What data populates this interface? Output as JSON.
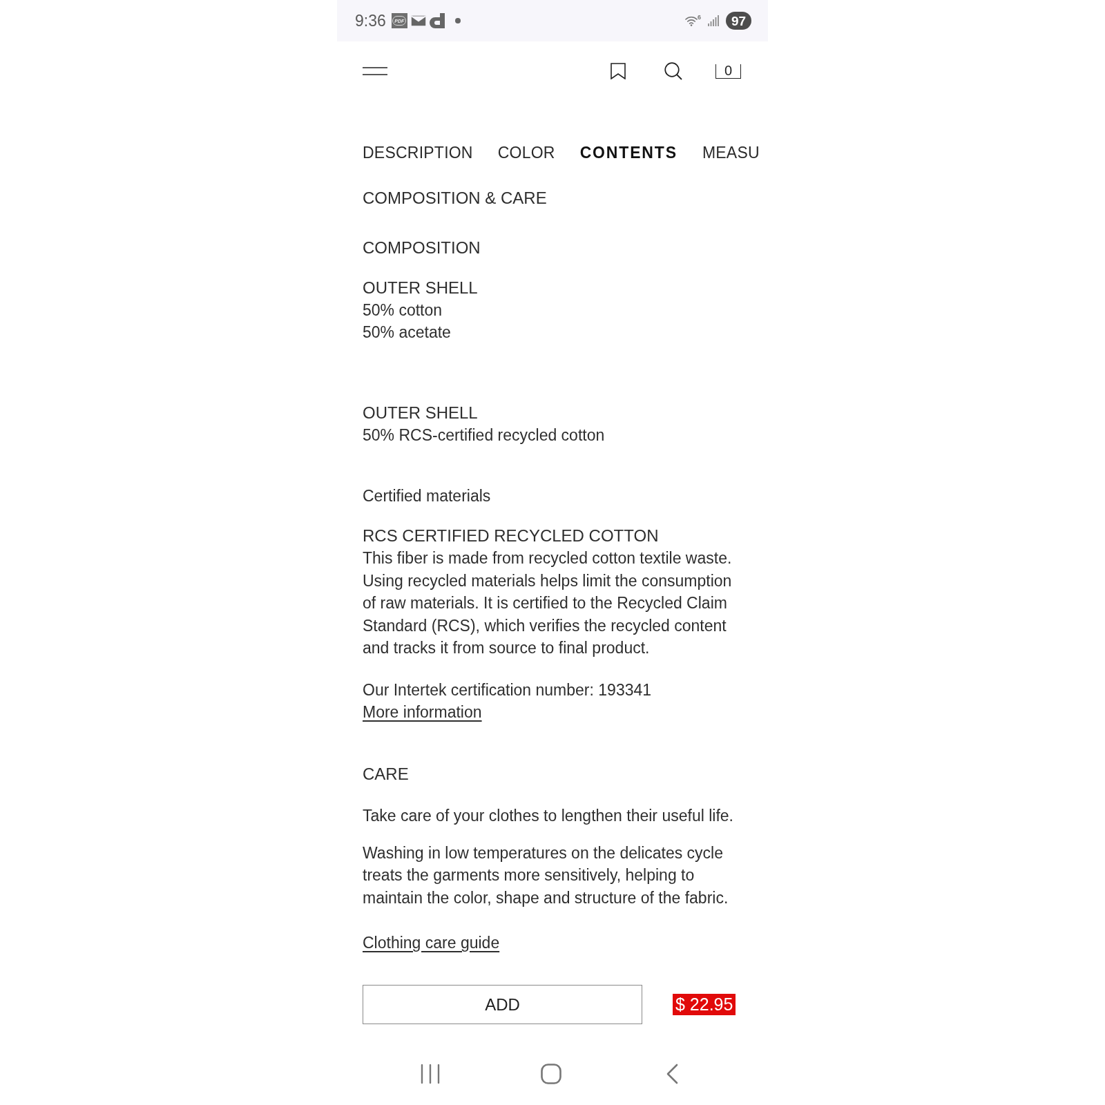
{
  "status_bar": {
    "time": "9:36",
    "notification_icons": [
      {
        "kind": "pdf",
        "label": "PDF"
      },
      {
        "kind": "mail"
      },
      {
        "kind": "app"
      },
      {
        "kind": "dot"
      }
    ],
    "wifi_label": "6",
    "battery": "97"
  },
  "header": {
    "cart_count": "0"
  },
  "tabs": [
    {
      "label": "DESCRIPTION",
      "selected": false
    },
    {
      "label": "COLOR",
      "selected": false
    },
    {
      "label": "CONTENTS",
      "selected": true
    },
    {
      "label": "MEASU",
      "selected": false
    }
  ],
  "content": {
    "title": "COMPOSITION & CARE",
    "composition": {
      "heading": "COMPOSITION",
      "groups": [
        {
          "title": "OUTER SHELL",
          "lines": [
            "50% cotton",
            "50% acetate"
          ]
        },
        {
          "title": "OUTER SHELL",
          "lines": [
            "50% RCS-certified recycled cotton"
          ]
        }
      ]
    },
    "certified": {
      "heading": "Certified materials",
      "material_title": "RCS CERTIFIED RECYCLED COTTON",
      "description": "This fiber is made from recycled cotton textile waste. Using recycled materials helps limit the consumption of raw materials. It is certified to the Recycled Claim Standard (RCS), which verifies the recycled content and tracks it from source to final product.",
      "certification": "Our Intertek certification number: 193341",
      "link": "More information"
    },
    "care": {
      "heading": "CARE",
      "intro": "Take care of your clothes to lengthen their useful life.",
      "text": "Washing in low temperatures on the delicates cycle treats the garments more sensitively, helping to maintain the color, shape and structure of the fabric.",
      "link": "Clothing care guide"
    }
  },
  "purchase": {
    "button": "ADD",
    "price": "$ 22.95"
  }
}
